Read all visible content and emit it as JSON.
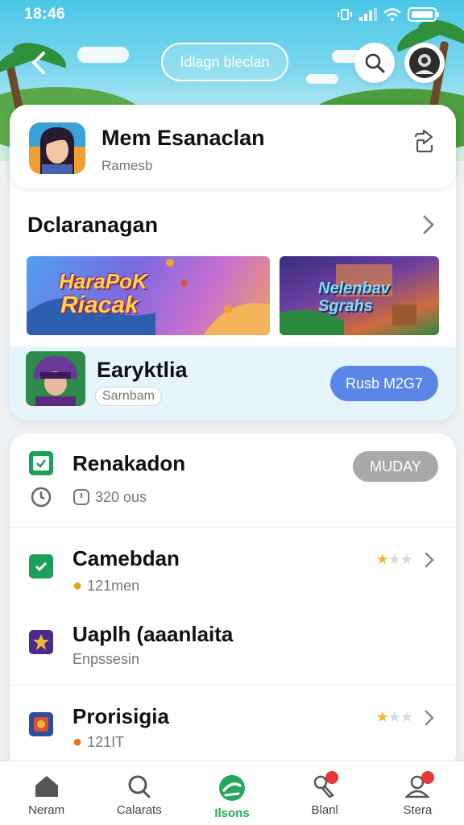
{
  "status_bar": {
    "time": "18:46"
  },
  "header": {
    "search_label": "Idlagn bleclan"
  },
  "profile": {
    "name": "Mem Esanaclan",
    "subtitle": "Ramesb"
  },
  "section": {
    "title": "Dclaranagan",
    "banners": [
      {
        "text_line1": "HaraPoK",
        "text_line2": "Riacak"
      },
      {
        "text_line1": "Nelenbav",
        "text_line2": "Sgrahs"
      }
    ]
  },
  "featured": {
    "name": "Earyktlia",
    "tag": "Sarnbam",
    "button_label": "Rusb M2G7"
  },
  "list": {
    "items": [
      {
        "title": "Renakadon",
        "meta": "320 ous",
        "badge": "MUDAY",
        "icon_color": "#1aa05a"
      },
      {
        "title": "Camebdan",
        "meta": "121men",
        "rating": 1,
        "icon_color": "#1aa05a"
      },
      {
        "title": "Uaplh (aaanlaita",
        "meta": "Enpssesin",
        "icon_color": "#4a2a8a"
      },
      {
        "title": "Prorisigia",
        "meta": "121IT",
        "rating": 1,
        "icon_color": "#2a4fa0"
      }
    ]
  },
  "bottom_nav": {
    "items": [
      {
        "label": "Neram"
      },
      {
        "label": "Calarats"
      },
      {
        "label": "Ilsons"
      },
      {
        "label": "Blanl"
      },
      {
        "label": "Stera"
      }
    ],
    "active_index": 2
  },
  "colors": {
    "accent_green": "#23a858",
    "accent_blue": "#5a86e8",
    "badge_red": "#e53935"
  }
}
